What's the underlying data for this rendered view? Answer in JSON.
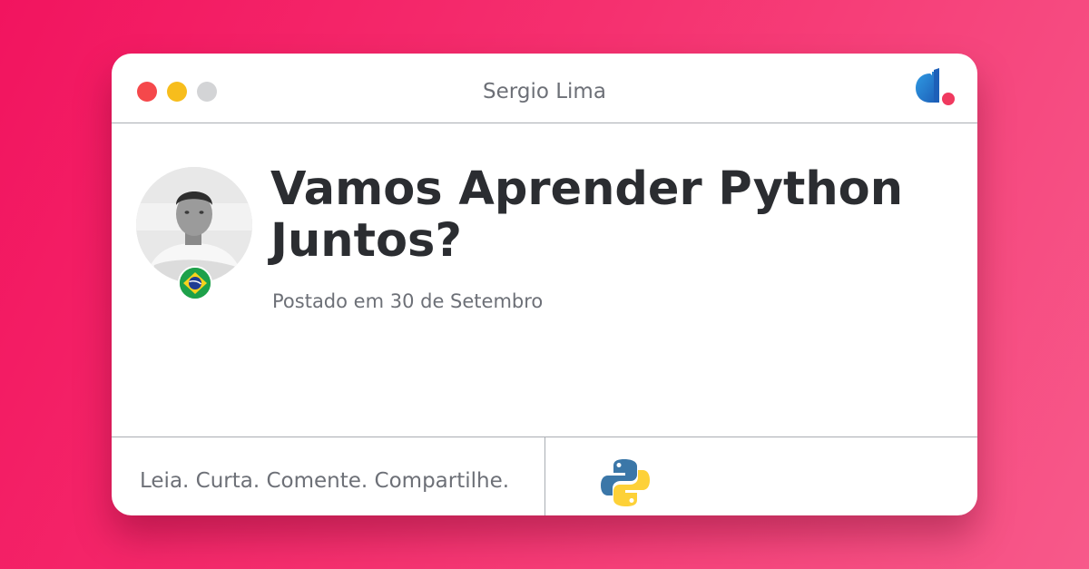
{
  "window": {
    "title": "Sergio Lima",
    "controls": [
      "close",
      "minimize",
      "maximize"
    ],
    "brand_icon": "devto-logo-icon"
  },
  "post": {
    "title": "Vamos Aprender Python Juntos?",
    "date": "Postado em 30 de Setembro",
    "author_avatar": "avatar",
    "author_flag_icon": "brazil-flag-icon"
  },
  "footer": {
    "tagline": "Leia. Curta. Comente. Compartilhe.",
    "tag_icon": "python-logo-icon"
  },
  "colors": {
    "background_start": "#f2145f",
    "background_end": "#f7598a",
    "close": "#f5484b",
    "minimize": "#f7bd1c",
    "maximize": "#d3d4d6",
    "title_text": "#2b2d31",
    "muted_text": "#6d7077"
  }
}
